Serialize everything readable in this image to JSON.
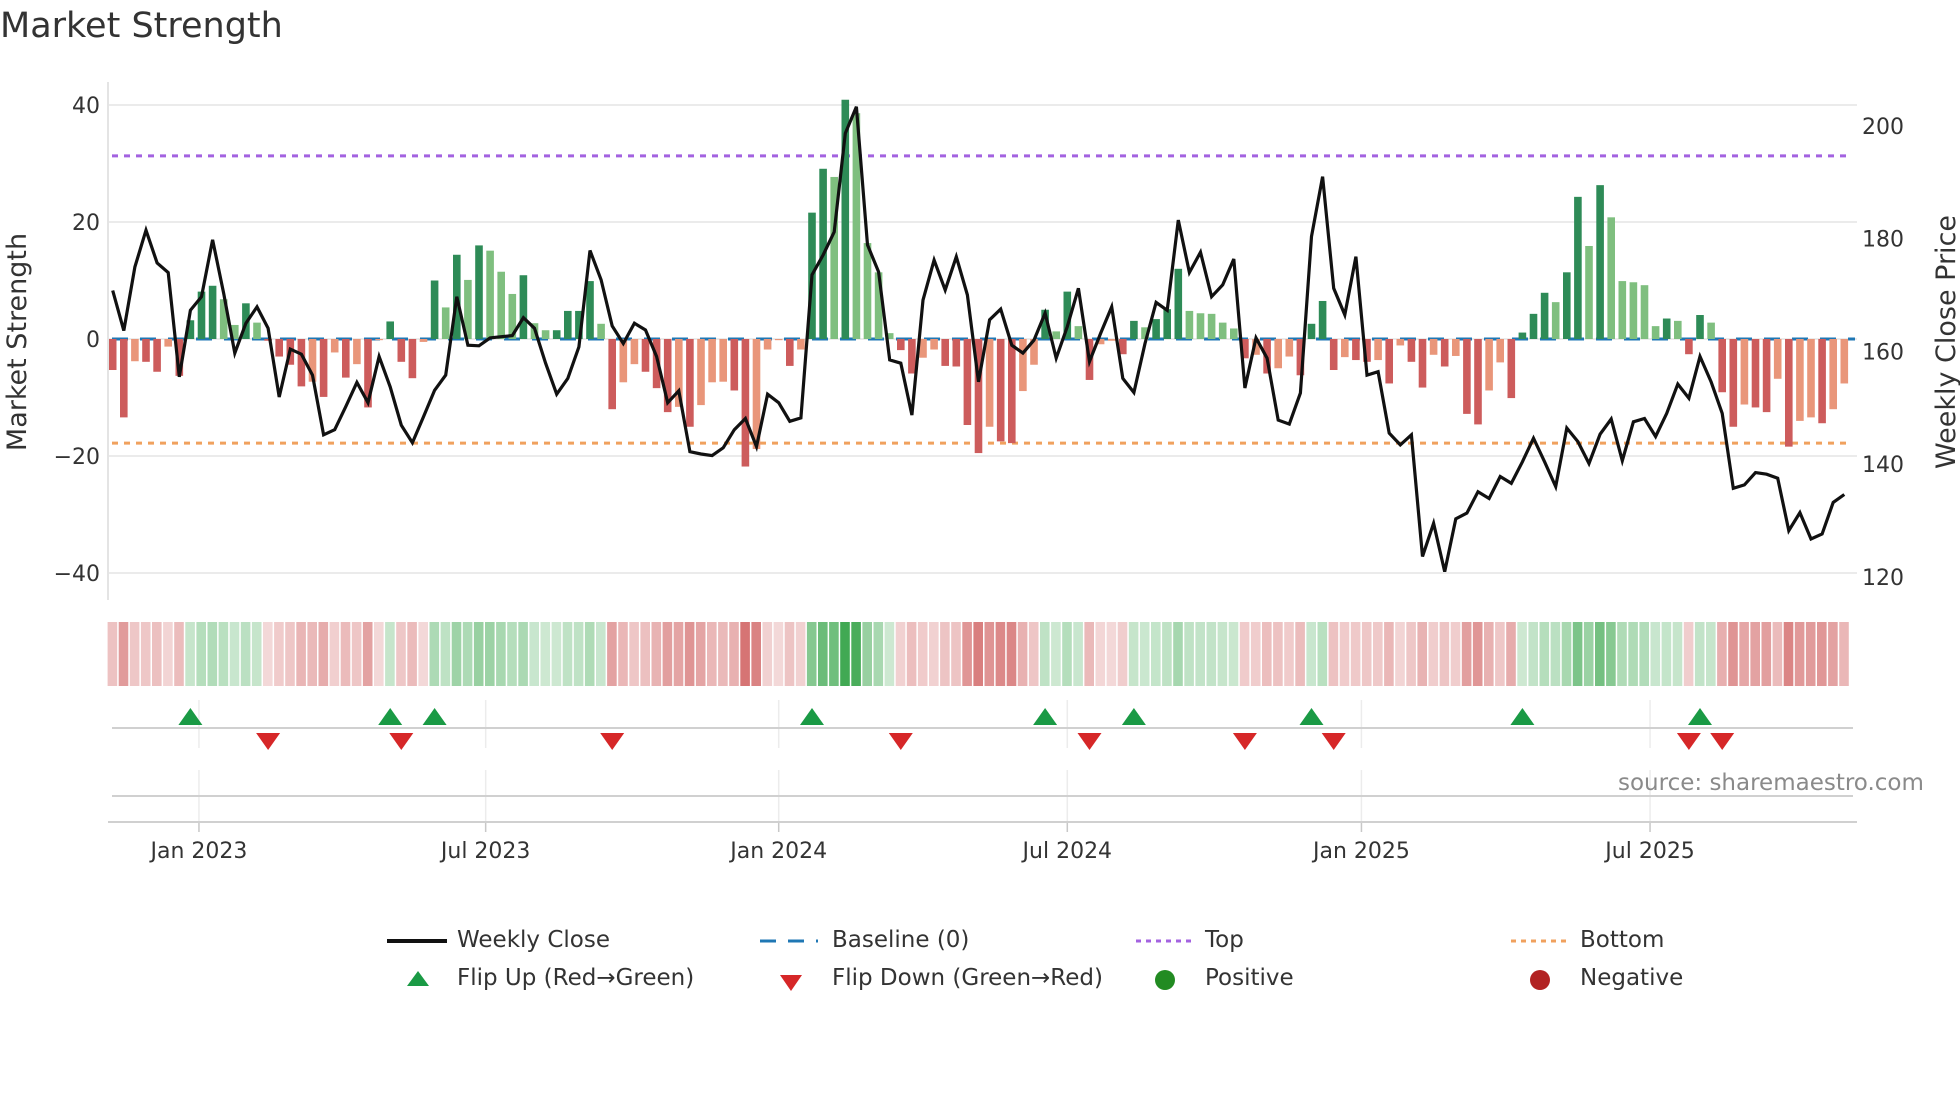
{
  "title": "Market Strength",
  "source": "source: sharemaestro.com",
  "colors": {
    "pos_strong": "#2e8b57",
    "pos_weak": "#7fbf7f",
    "neg_strong": "#cd5c5c",
    "neg_weak": "#e9967a",
    "baseline": "#1f77b4",
    "top": "#a362e0",
    "bottom": "#f0a15e",
    "line": "#111111",
    "flip_up": "#1a9a45",
    "flip_down": "#d62728",
    "positive": "#228b22",
    "negative": "#b22222"
  },
  "chart_data": {
    "type": "bar+line",
    "title": "Market Strength",
    "ylabel": "Market Strength",
    "ylabel_right": "Weekly Close Price",
    "ylim": [
      -45,
      44
    ],
    "ylim_right": [
      118,
      205
    ],
    "yticks": [
      40,
      20,
      0,
      -20,
      -40
    ],
    "yticks_labels": [
      "40",
      "20",
      "0",
      "−20",
      "−40"
    ],
    "yticks_right": [
      200,
      180,
      160,
      140,
      120
    ],
    "yticks_right_labels": [
      "200",
      "180",
      "160",
      "140",
      "120"
    ],
    "xticks": [
      {
        "week": 8.77,
        "label": "Jan 2023"
      },
      {
        "week": 34.6,
        "label": "Jul 2023"
      },
      {
        "week": 61.0,
        "label": "Jan 2024"
      },
      {
        "week": 87.0,
        "label": "Jul 2024"
      },
      {
        "week": 113.5,
        "label": "Jan 2025"
      },
      {
        "week": 139.5,
        "label": "Jul 2025"
      }
    ],
    "top_level": 31.3,
    "bottom_level": -17.8,
    "baseline": 0,
    "strength": [
      -5.3,
      -13.4,
      -3.8,
      -3.9,
      -5.6,
      -1.3,
      -6.3,
      3.2,
      8.1,
      9.1,
      6.8,
      2.4,
      6.1,
      2.8,
      -0.3,
      -3.0,
      -4.4,
      -8.1,
      -7.3,
      -9.9,
      -2.3,
      -6.6,
      -4.3,
      -11.7,
      -0.2,
      3.0,
      -3.9,
      -6.7,
      -0.5,
      10.0,
      5.4,
      14.4,
      10.1,
      16.0,
      15.1,
      11.5,
      7.7,
      10.9,
      2.7,
      1.5,
      1.5,
      4.8,
      4.8,
      9.9,
      2.6,
      -12.0,
      -7.4,
      -4.3,
      -5.6,
      -8.4,
      -12.5,
      -11.6,
      -15.0,
      -11.3,
      -7.4,
      -7.3,
      -8.8,
      -21.8,
      -18.8,
      -1.8,
      -0.2,
      -4.6,
      -1.8,
      21.6,
      29.1,
      27.7,
      40.9,
      38.6,
      16.4,
      11.4,
      1.0,
      -1.9,
      -5.9,
      -3.2,
      -1.8,
      -4.6,
      -4.7,
      -14.7,
      -19.5,
      -15.0,
      -17.5,
      -17.8,
      -8.9,
      -4.4,
      5.0,
      1.3,
      8.1,
      2.2,
      -7.0,
      -0.9,
      -0.3,
      -2.6,
      3.1,
      2.0,
      3.4,
      5.1,
      12.0,
      4.8,
      4.4,
      4.3,
      2.8,
      1.8,
      -3.3,
      -2.7,
      -5.9,
      -5.0,
      -3.0,
      -6.2,
      2.6,
      6.5,
      -5.3,
      -3.1,
      -3.6,
      -3.9,
      -3.6,
      -7.6,
      -1.1,
      -3.9,
      -8.3,
      -2.7,
      -4.7,
      -2.9,
      -12.8,
      -14.6,
      -8.8,
      -4.0,
      -10.1,
      1.1,
      4.3,
      7.9,
      6.3,
      11.4,
      24.3,
      15.9,
      26.3,
      20.8,
      9.9,
      9.7,
      9.2,
      2.2,
      3.5,
      3.1,
      -2.6,
      4.1,
      2.8,
      -9.1,
      -15.0,
      -11.2,
      -11.7,
      -12.5,
      -6.8,
      -18.4,
      -14.0,
      -13.4,
      -14.4,
      -12.0,
      -7.6
    ],
    "weekly_close": [
      170.8,
      163.7,
      175.0,
      181.5,
      175.7,
      174.0,
      155.5,
      167.3,
      169.7,
      179.8,
      170.3,
      159.7,
      165.0,
      167.9,
      164.1,
      151.9,
      160.4,
      159.5,
      155.8,
      145.2,
      146.1,
      150.2,
      154.5,
      150.9,
      159.1,
      153.7,
      146.9,
      143.8,
      148.4,
      153.1,
      155.8,
      169.7,
      161.1,
      161.0,
      162.4,
      162.6,
      162.8,
      166.0,
      164.1,
      157.9,
      152.4,
      155.2,
      160.8,
      177.9,
      172.7,
      164.5,
      161.4,
      165.0,
      163.8,
      159.1,
      150.9,
      153.0,
      142.2,
      141.8,
      141.5,
      142.9,
      146.1,
      148.1,
      143.1,
      152.4,
      150.9,
      147.6,
      148.2,
      173.6,
      177.1,
      181.2,
      198.7,
      203.4,
      178.9,
      174.1,
      158.5,
      157.9,
      148.7,
      169.1,
      176.2,
      170.9,
      176.8,
      170.0,
      154.6,
      165.6,
      167.5,
      161.1,
      159.7,
      162.0,
      166.8,
      158.8,
      164.4,
      171.2,
      158.2,
      163.2,
      167.9,
      155.2,
      152.7,
      161.4,
      168.7,
      167.3,
      183.3,
      174.0,
      177.6,
      169.7,
      171.8,
      176.4,
      153.5,
      162.4,
      158.8,
      147.8,
      147.1,
      152.6,
      180.4,
      191.0,
      171.2,
      166.5,
      176.8,
      155.8,
      156.4,
      145.5,
      143.4,
      145.2,
      123.6,
      129.5,
      120.9,
      130.3,
      131.3,
      135.1,
      133.9,
      137.8,
      136.6,
      140.4,
      144.6,
      140.4,
      136.0,
      146.4,
      144.0,
      140.1,
      145.3,
      148.0,
      140.6,
      147.5,
      148.1,
      144.9,
      149.0,
      154.2,
      151.7,
      159.1,
      154.6,
      149.0,
      135.7,
      136.3,
      138.5,
      138.2,
      137.5,
      128.2,
      131.4,
      126.7,
      127.6,
      133.2,
      134.6
    ],
    "flip_up_weeks": [
      8,
      26,
      30,
      64,
      85,
      93,
      109,
      128,
      144
    ],
    "flip_down_weeks": [
      15,
      27,
      46,
      72,
      89,
      103,
      111,
      143,
      146
    ],
    "legend": {
      "weekly_close": "Weekly Close",
      "baseline": "Baseline (0)",
      "top": "Top",
      "bottom": "Bottom",
      "flip_up": "Flip Up (Red→Green)",
      "flip_down": "Flip Down (Green→Red)",
      "positive": "Positive",
      "negative": "Negative"
    },
    "legend_placement": "bottom-center"
  }
}
